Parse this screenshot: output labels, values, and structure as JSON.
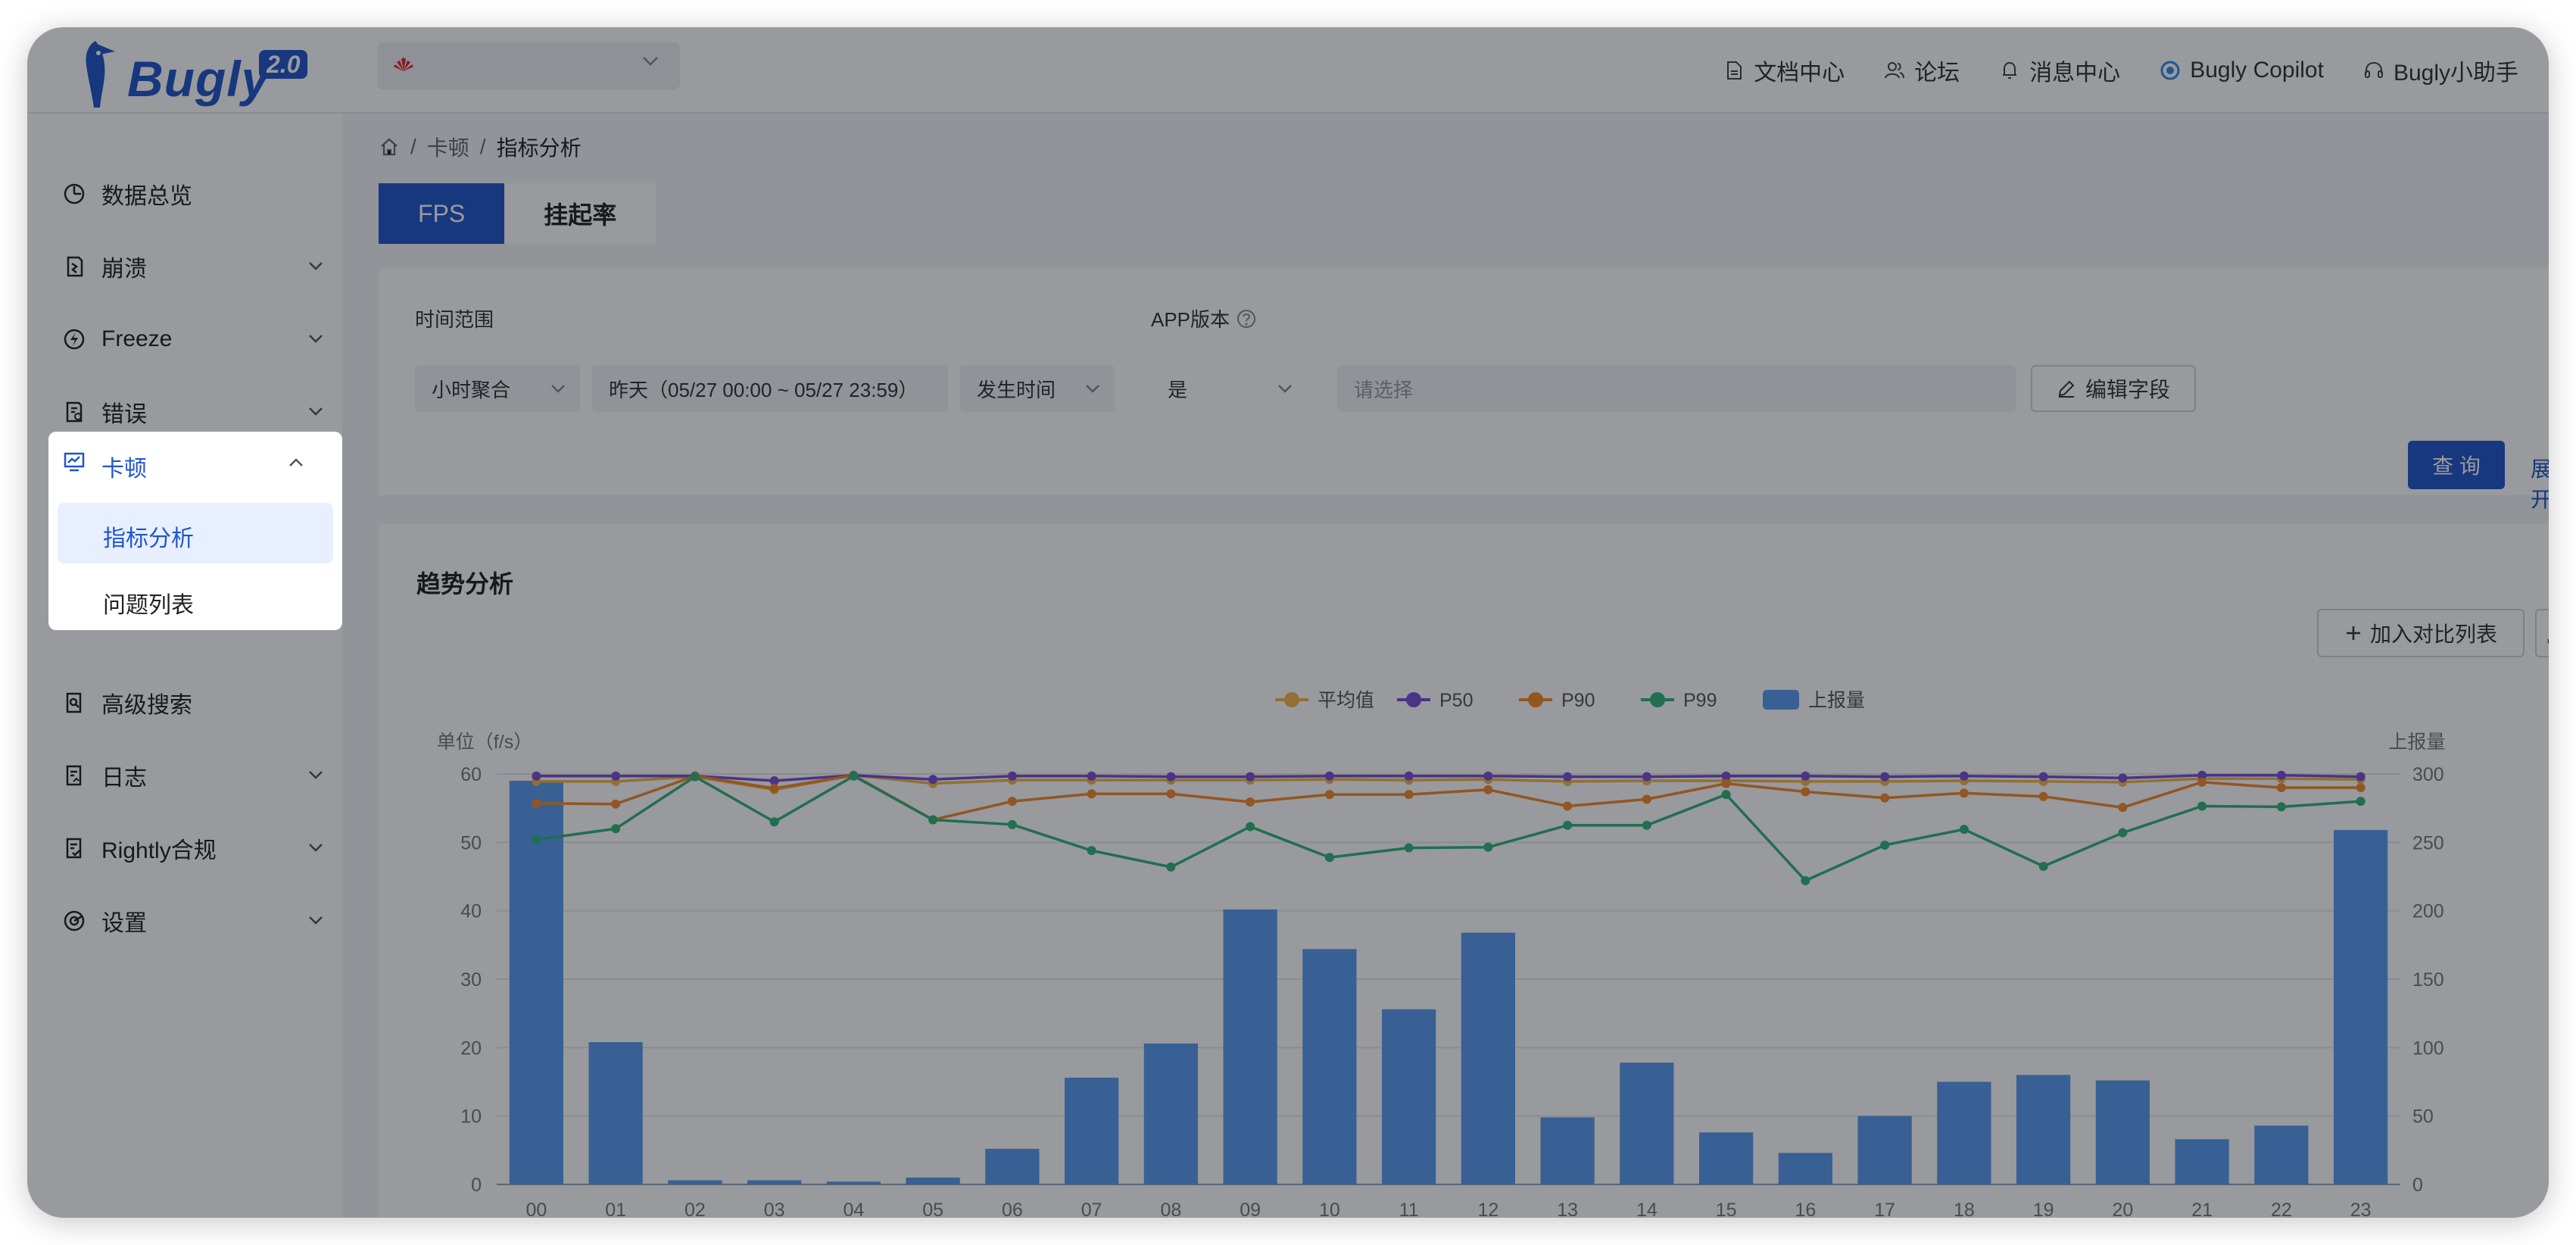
{
  "app": {
    "brand": "Bugly",
    "version": "2.0"
  },
  "topnav": [
    {
      "label": "文档中心",
      "icon": "document-icon"
    },
    {
      "label": "论坛",
      "icon": "users-icon"
    },
    {
      "label": "消息中心",
      "icon": "bell-icon"
    },
    {
      "label": "Bugly Copilot",
      "icon": "copilot-icon"
    },
    {
      "label": "Bugly小助手",
      "icon": "headset-icon"
    }
  ],
  "sidebar": {
    "items": [
      {
        "label": "数据总览",
        "icon": "pie-chart-icon",
        "expandable": false
      },
      {
        "label": "崩溃",
        "icon": "crash-icon",
        "expandable": true
      },
      {
        "label": "Freeze",
        "icon": "lightning-icon",
        "expandable": true
      },
      {
        "label": "错误",
        "icon": "error-doc-icon",
        "expandable": true
      },
      {
        "label": "卡顿",
        "icon": "monitor-chart-icon",
        "expandable": true,
        "active": true
      },
      {
        "label": "指标分析",
        "sub": true,
        "selected": true
      },
      {
        "label": "问题列表",
        "sub": true
      },
      {
        "label": "高级搜索",
        "icon": "search-doc-icon",
        "expandable": false
      },
      {
        "label": "日志",
        "icon": "log-icon",
        "expandable": true
      },
      {
        "label": "Rightly合规",
        "icon": "compliance-icon",
        "expandable": true
      },
      {
        "label": "设置",
        "icon": "settings-icon",
        "expandable": true
      }
    ]
  },
  "breadcrumb": {
    "sep": "/",
    "level1": "卡顿",
    "current": "指标分析"
  },
  "tabs": [
    {
      "label": "FPS",
      "active": true
    },
    {
      "label": "挂起率",
      "active": false
    }
  ],
  "filter": {
    "time_range_label": "时间范围",
    "aggregation": "小时聚合",
    "date_range": "昨天（05/27 00:00 ~ 05/27 23:59）",
    "time_type": "发生时间",
    "app_version_label": "APP版本",
    "version_op": "是",
    "version_placeholder": "请选择",
    "edit_fields": "编辑字段",
    "query": "查 询",
    "expand": "展开"
  },
  "trend": {
    "title": "趋势分析",
    "add_compare": "加入对比列表"
  },
  "chart_data": {
    "type": "bar+line",
    "left_unit": "单位（f/s）",
    "right_unit": "上报量",
    "x": [
      "00",
      "01",
      "02",
      "03",
      "04",
      "05",
      "06",
      "07",
      "08",
      "09",
      "10",
      "11",
      "12",
      "13",
      "14",
      "15",
      "16",
      "17",
      "18",
      "19",
      "20",
      "21",
      "22",
      "23"
    ],
    "ylim_left": [
      0,
      60
    ],
    "yticks_left": [
      0,
      10,
      20,
      30,
      40,
      50,
      60
    ],
    "ylim_right": [
      0,
      300
    ],
    "yticks_right": [
      0,
      50,
      100,
      150,
      200,
      250,
      300
    ],
    "bar_series": {
      "name": "上报量",
      "color": "#5b9bf0",
      "axis": "right",
      "values": [
        295,
        104,
        3,
        3,
        2,
        5,
        26,
        78,
        103,
        201,
        172,
        128,
        184,
        49,
        89,
        38,
        23,
        50,
        75,
        80,
        76,
        33,
        43,
        259
      ]
    },
    "line_series": [
      {
        "name": "平均值",
        "color": "#f5b54a",
        "values": [
          58.9,
          58.9,
          59.6,
          57.7,
          59.8,
          58.6,
          59.1,
          59.1,
          59.1,
          59.1,
          59.2,
          59.1,
          59.2,
          58.9,
          59.0,
          59.0,
          58.9,
          58.9,
          59.0,
          58.9,
          58.8,
          59.3,
          59.3,
          59.2
        ]
      },
      {
        "name": "P50",
        "color": "#7b4fd6",
        "values": [
          59.7,
          59.7,
          59.7,
          59.0,
          59.8,
          59.2,
          59.7,
          59.7,
          59.6,
          59.6,
          59.7,
          59.7,
          59.7,
          59.6,
          59.6,
          59.7,
          59.7,
          59.6,
          59.7,
          59.6,
          59.4,
          59.8,
          59.8,
          59.6
        ]
      },
      {
        "name": "P90",
        "color": "#f58a2b",
        "values": [
          55.7,
          55.6,
          59.7,
          57.9,
          59.8,
          53.3,
          56.0,
          57.1,
          57.1,
          55.9,
          57.0,
          57.0,
          57.7,
          55.3,
          56.3,
          58.6,
          57.4,
          56.5,
          57.2,
          56.7,
          55.1,
          58.8,
          58.0,
          58.0
        ]
      },
      {
        "name": "P99",
        "color": "#33b37a",
        "values": [
          50.4,
          52.0,
          59.6,
          53.0,
          59.7,
          53.3,
          52.6,
          48.8,
          46.4,
          52.3,
          47.8,
          49.2,
          49.3,
          52.5,
          52.5,
          57.0,
          44.4,
          49.6,
          51.9,
          46.5,
          51.4,
          55.3,
          55.2,
          56.0
        ]
      }
    ],
    "legend": [
      "平均值",
      "P50",
      "P90",
      "P99",
      "上报量"
    ],
    "legend_position": "top-center"
  }
}
